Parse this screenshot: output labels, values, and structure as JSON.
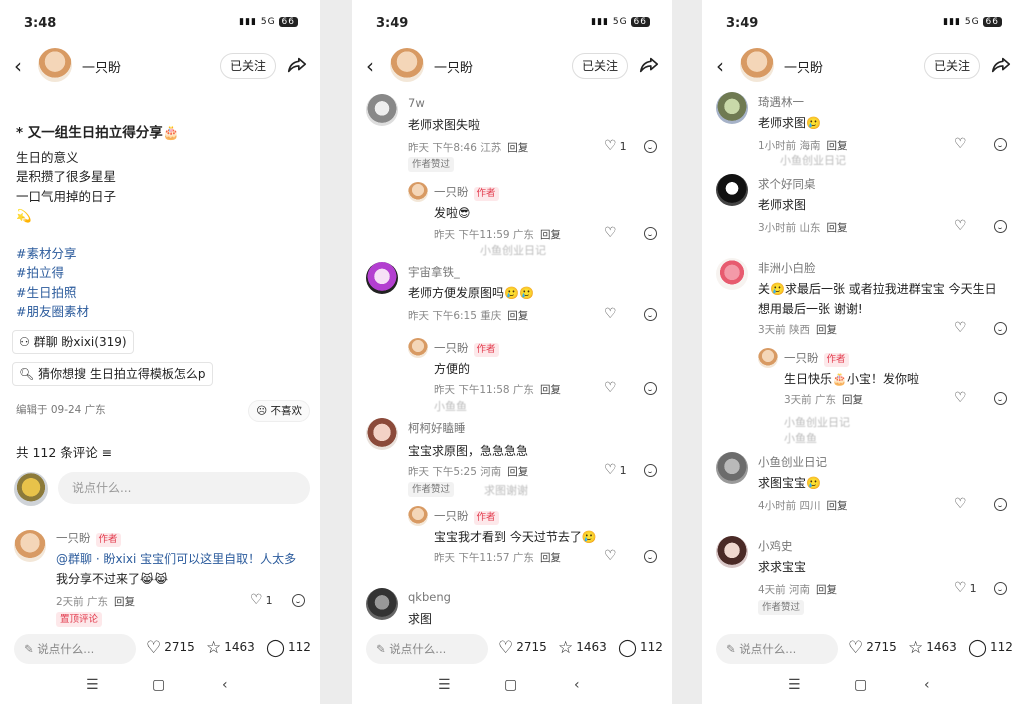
{
  "colors": {
    "accent": "#e23b4d",
    "tag": "#2b5b9c"
  },
  "screens": [
    {
      "status": {
        "time": "3:48",
        "battery": "66",
        "signal": "5G"
      },
      "nav": {
        "name": "一只盼",
        "follow": "已关注"
      },
      "post": {
        "title": "* 又一组生日拍立得分享🎂",
        "lines": [
          "生日的意义",
          "是积攒了很多星星",
          "一口气用掉的日子",
          "💫"
        ],
        "tags": [
          "#素材分享",
          "#拍立得",
          "#生日拍照",
          "#朋友圈素材"
        ],
        "group_chip": "群聊  盼xixi(319)",
        "search_chip": "猜你想搜  生日拍立得模板怎么p",
        "edited": "编辑于 09-24 广东",
        "dislike": "不喜欢"
      },
      "comments_header": "共 112 条评论",
      "input_placeholder": "说点什么...",
      "pinned": {
        "name": "一只盼",
        "author": "作者",
        "text1": "@群聊 · 盼xixi 宝宝们可以这里自取！人太多",
        "text2": "我分享不过来了😹😹",
        "meta": "2天前 广东",
        "reply": "回复",
        "likes": "1",
        "pin": "置顶评论"
      },
      "bottom": {
        "input": "说点什么...",
        "likes": "2715",
        "stars": "1463",
        "comments": "112"
      }
    },
    {
      "status": {
        "time": "3:49",
        "battery": "66",
        "signal": "5G"
      },
      "nav": {
        "name": "一只盼",
        "follow": "已关注"
      },
      "comments": [
        {
          "name": "7w",
          "text": "老师求图失啦",
          "meta": "昨天 下午8:46 江苏",
          "reply": "回复",
          "likes": "1",
          "pill": "作者赞过"
        },
        {
          "name": "一只盼",
          "author": "作者",
          "text": "发啦😎",
          "meta": "昨天 下午11:59 广东",
          "reply": "回复",
          "blur": "小鱼创业日记"
        },
        {
          "name": "宇宙拿铁_",
          "text": "老师方便发原图吗🥲🥲",
          "meta": "昨天 下午6:15 重庆",
          "reply": "回复"
        },
        {
          "name": "一只盼",
          "author": "作者",
          "text": "方便的",
          "meta": "昨天 下午11:58 广东",
          "reply": "回复",
          "blur": "小鱼鱼"
        },
        {
          "name": "柯柯好瞌睡",
          "text": "宝宝求原图，急急急急",
          "meta": "昨天 下午5:25 河南",
          "reply": "回复",
          "likes": "1",
          "pill": "作者赞过",
          "blur": "求图谢谢"
        },
        {
          "name": "一只盼",
          "author": "作者",
          "text": "宝宝我才看到 今天过节去了🥲",
          "meta": "昨天 下午11:57 广东",
          "reply": "回复"
        },
        {
          "name": "qkbeng",
          "text": "求图"
        }
      ],
      "bottom": {
        "input": "说点什么...",
        "likes": "2715",
        "stars": "1463",
        "comments": "112"
      }
    },
    {
      "status": {
        "time": "3:49",
        "battery": "66",
        "signal": "5G"
      },
      "nav": {
        "name": "一只盼",
        "follow": "已关注"
      },
      "comments": [
        {
          "name": "琦遇林一",
          "text": "老师求图🥲",
          "meta": "1小时前 海南",
          "reply": "回复",
          "blur": "小鱼创业日记"
        },
        {
          "name": "求个好同桌",
          "text": "老师求图",
          "meta": "3小时前 山东",
          "reply": "回复"
        },
        {
          "name": "非洲小白脸",
          "text": "关🥲求最后一张 或者拉我进群宝宝 今天生日",
          "text2": "想用最后一张 谢谢!",
          "meta": "3天前 陕西",
          "reply": "回复"
        },
        {
          "name": "一只盼",
          "author": "作者",
          "text": "生日快乐🎂小宝！发你啦",
          "meta": "3天前 广东",
          "reply": "回复",
          "blur": "小鱼创业日记",
          "blur2": "小鱼鱼"
        },
        {
          "name": "小鱼创业日记",
          "text": "求图宝宝🥲",
          "meta": "4小时前 四川",
          "reply": "回复"
        },
        {
          "name": "小鸡史",
          "text": "求求宝宝",
          "meta": "4天前 河南",
          "reply": "回复",
          "likes": "1",
          "pill": "作者赞过"
        }
      ],
      "bottom": {
        "input": "说点什么...",
        "likes": "2715",
        "stars": "1463",
        "comments": "112"
      }
    }
  ]
}
